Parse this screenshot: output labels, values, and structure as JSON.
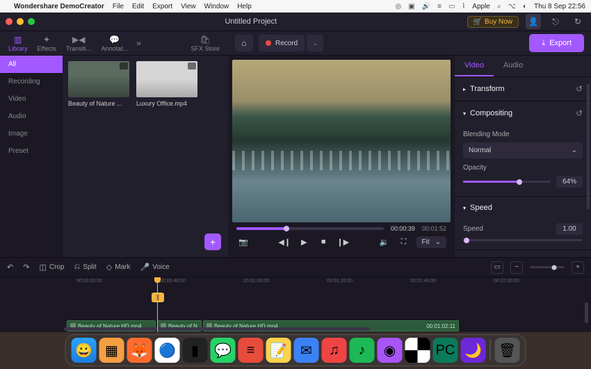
{
  "menubar": {
    "app_name": "Wondershare DemoCreator",
    "items": [
      "File",
      "Edit",
      "Export",
      "View",
      "Window",
      "Help"
    ],
    "right_label": "Apple",
    "datetime": "Thu 8 Sep 22:56"
  },
  "titlebar": {
    "title": "Untitled Project",
    "buy_now": "Buy Now"
  },
  "nav_tabs": {
    "library": "Library",
    "effects": "Effects",
    "transitions": "Transiti...",
    "annotations": "Annotat...",
    "sfx": "SFX Store"
  },
  "toolbar": {
    "record": "Record",
    "export": "Export"
  },
  "library": {
    "categories": [
      "All",
      "Recording",
      "Video",
      "Audio",
      "Image",
      "Preset"
    ],
    "items": [
      {
        "name": "Beauty of Nature ..."
      },
      {
        "name": "Luxury Office.mp4"
      }
    ]
  },
  "preview": {
    "current_time": "00:00:39",
    "total_time": "00:01:52",
    "fit_label": "Fit"
  },
  "props": {
    "tabs": {
      "video": "Video",
      "audio": "Audio"
    },
    "transform": "Transform",
    "compositing": "Compositing",
    "blending_mode_label": "Blending Mode",
    "blending_mode_value": "Normal",
    "opacity_label": "Opacity",
    "opacity_value": "64%",
    "speed_section": "Speed",
    "speed_label": "Speed",
    "speed_value": "1.00"
  },
  "timeline": {
    "tools": {
      "crop": "Crop",
      "split": "Split",
      "mark": "Mark",
      "voice": "Voice"
    },
    "ruler": [
      "00:00:20:00",
      "00:00:40:00",
      "00:01:00:00",
      "00:01:20:00",
      "00:01:40:00",
      "00:02:00:00"
    ],
    "playhead_label": "][",
    "clips": [
      {
        "name": "Beauty of Nature HD.mp4",
        "time": ""
      },
      {
        "name": "Beauty of N",
        "time": ""
      },
      {
        "name": "Beauty of Nature HD.mp4",
        "time": "00:01:02:11"
      }
    ]
  }
}
